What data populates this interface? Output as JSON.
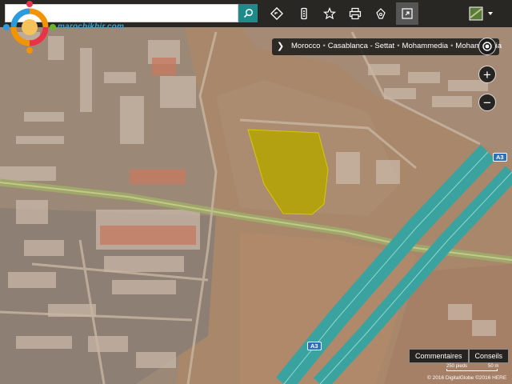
{
  "search": {
    "value": "",
    "placeholder": ""
  },
  "logo": {
    "text": "marocbikhir.com"
  },
  "toolbar": {
    "items": [
      "directions-icon",
      "traffic-icon",
      "favorites-icon",
      "print-icon",
      "share-icon",
      "fullscreen-icon"
    ],
    "map_style_icon": "aerial-view-icon"
  },
  "breadcrumb": {
    "items": [
      "Morocco",
      "Casablanca - Settat",
      "Mohammedia",
      "Mohammedia"
    ]
  },
  "zoom": {
    "in_label": "+",
    "out_label": "−"
  },
  "road_shields": {
    "upper": "A3",
    "lower": "A3"
  },
  "bottom": {
    "comments_label": "Commentaires",
    "tips_label": "Conseils",
    "scale_feet": "250 pieds",
    "scale_meters": "50 m",
    "copyright": "© 2016 DigitalGlobe ©2016 HERE"
  },
  "colors": {
    "highlight": "#b5a400",
    "toolbar": "#1e1e1e",
    "accent": "#1e8a8a",
    "highway": "#3aa3a0"
  }
}
